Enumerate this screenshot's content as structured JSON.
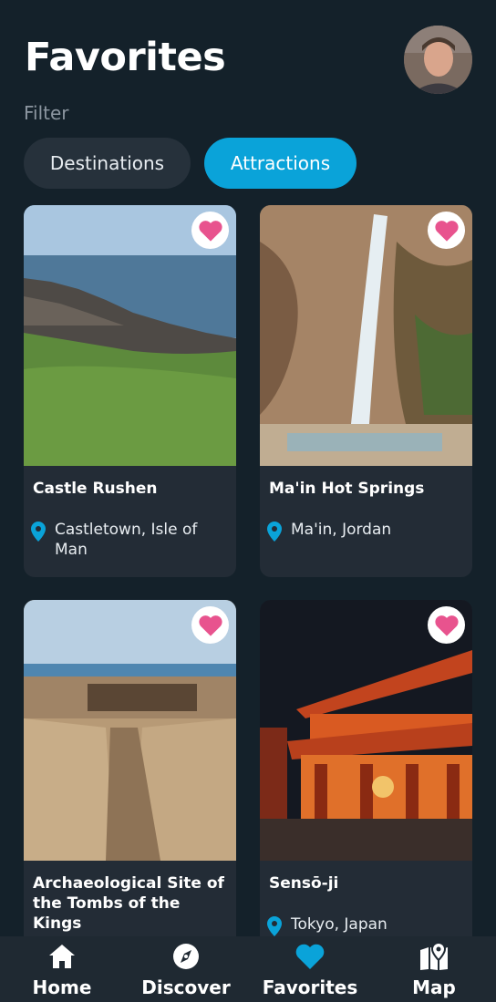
{
  "header": {
    "title": "Favorites"
  },
  "filter": {
    "label": "Filter",
    "chips": [
      "Destinations",
      "Attractions"
    ],
    "selected": "Attractions"
  },
  "colors": {
    "accent": "#0aa3d9",
    "heart": "#e8538e",
    "pin": "#0aa3d9",
    "background": "#14212a",
    "card": "#232c36"
  },
  "cards": [
    {
      "title": "Castle Rushen",
      "location": "Castletown, Isle of Man",
      "favorited": true
    },
    {
      "title": "Ma'in Hot Springs",
      "location": "Ma'in, Jordan",
      "favorited": true
    },
    {
      "title": "Archaeological Site of the Tombs of the Kings",
      "location": "",
      "favorited": true
    },
    {
      "title": "Sensō-ji",
      "location": "Tokyo, Japan",
      "favorited": true
    }
  ],
  "nav": {
    "items": [
      {
        "label": "Home",
        "icon": "home-icon"
      },
      {
        "label": "Discover",
        "icon": "compass-icon"
      },
      {
        "label": "Favorites",
        "icon": "heart-icon"
      },
      {
        "label": "Map",
        "icon": "map-icon"
      }
    ],
    "active": "Favorites"
  }
}
